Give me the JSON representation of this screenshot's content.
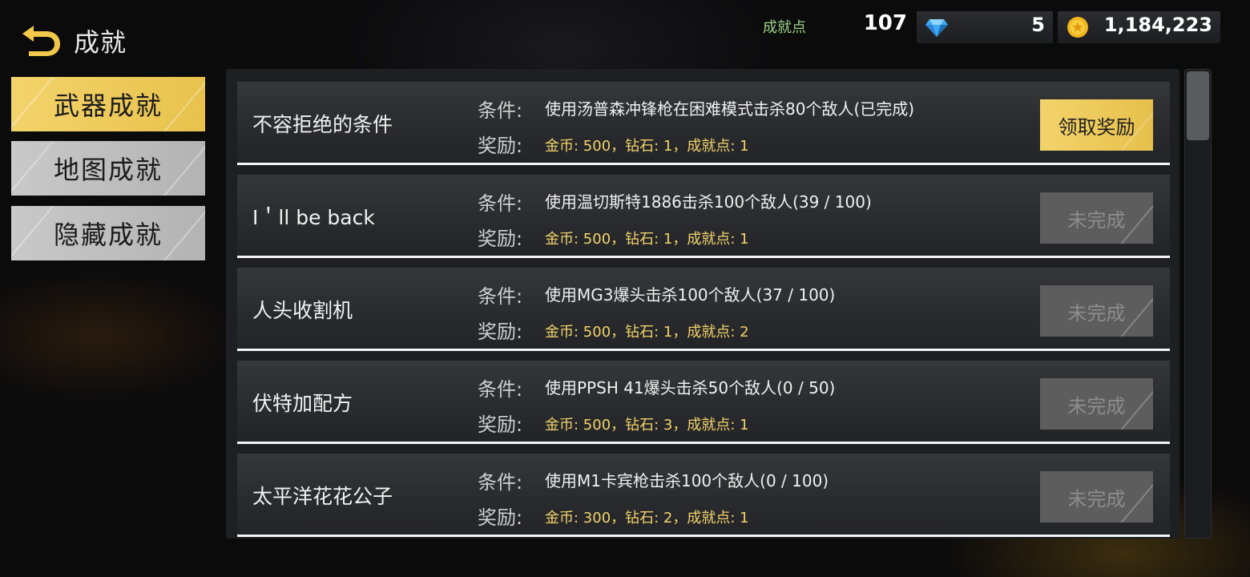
{
  "header": {
    "title": "成就",
    "achievement_points_label": "成就点",
    "achievement_points_value": "107",
    "diamonds": "5",
    "coins": "1,184,223"
  },
  "tabs": [
    {
      "label": "武器成就",
      "active": true
    },
    {
      "label": "地图成就",
      "active": false
    },
    {
      "label": "隐藏成就",
      "active": false
    }
  ],
  "labels": {
    "condition": "条件:",
    "reward": "奖励:"
  },
  "achievements": [
    {
      "name": "不容拒绝的条件",
      "condition": "使用汤普森冲锋枪在困难模式击杀80个敌人(已完成)",
      "reward": "金币: 500，钻石: 1，成就点: 1",
      "button": "领取奖励",
      "status": "claimable"
    },
    {
      "name": "I＇ll be back",
      "condition": "使用温切斯特1886击杀100个敌人(39 / 100)",
      "reward": "金币: 500，钻石: 1，成就点: 1",
      "button": "未完成",
      "status": "incomplete"
    },
    {
      "name": "人头收割机",
      "condition": "使用MG3爆头击杀100个敌人(37 / 100)",
      "reward": "金币: 500，钻石: 1，成就点: 2",
      "button": "未完成",
      "status": "incomplete"
    },
    {
      "name": "伏特加配方",
      "condition": "使用PPSH 41爆头击杀50个敌人(0 / 50)",
      "reward": "金币: 500，钻石: 3，成就点: 1",
      "button": "未完成",
      "status": "incomplete"
    },
    {
      "name": "太平洋花花公子",
      "condition": "使用M1卡宾枪击杀100个敌人(0 / 100)",
      "reward": "金币: 300，钻石: 2，成就点: 1",
      "button": "未完成",
      "status": "incomplete"
    }
  ],
  "colors": {
    "accent_gold": "#f3d36b",
    "reward_text": "#f2d36a",
    "points_label": "#9ed08a",
    "disabled_button": "#5d5d5e"
  },
  "icons": {
    "back": "back-arrow-icon",
    "diamond": "diamond-icon",
    "coin": "coin-icon"
  }
}
